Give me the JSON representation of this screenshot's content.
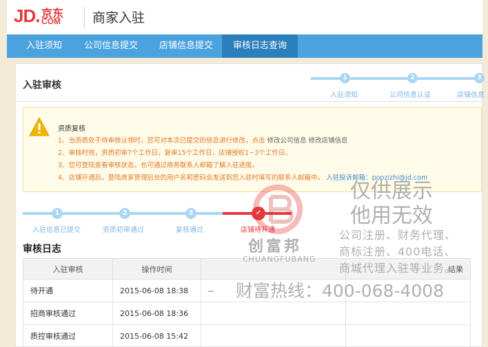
{
  "header": {
    "logo_jd": "JD.",
    "logo_cn": "京东",
    "logo_com": "COM",
    "title": "商家入驻"
  },
  "nav": {
    "items": [
      "入驻须知",
      "公司信息提交",
      "店铺信息提交",
      "审核日志查询"
    ],
    "active_index": 3
  },
  "panel": {
    "title": "入驻审核",
    "mini_steps": {
      "numbers": [
        "1",
        "2",
        "3"
      ],
      "labels": [
        "入驻须知",
        "公司信息认证",
        "店铺信息"
      ]
    }
  },
  "notice": {
    "title": "资质复核",
    "line1_prefix": "1、当资质处于待审核认领时，您可对本次已提交的信息进行修改，点击",
    "line1_link1": "修改公司信息",
    "line1_link2": "修改店铺信息",
    "line2": "2、审核时效，资质初审7个工作日，复审15个工作日，店铺授权1~3个工作日。",
    "line3": "3、您可登陆查看审核状态，也可通过商务联系人邮箱了解入驻进度。",
    "line4_prefix": "4、店铺开通后，登陆商家管理后台的用户名和密码会发送到您入驻时填写的联系人邮箱中。",
    "line4_link": "入驻投诉邮箱：popzizhi@jd.com"
  },
  "steps": {
    "numbers": [
      "1",
      "2",
      "3"
    ],
    "labels": [
      "入驻信息已提交",
      "资质初审通过",
      "复核通过",
      "店铺待开通"
    ],
    "current_index": 3
  },
  "log": {
    "title": "审核日志",
    "columns": [
      "入驻审核",
      "操作时间",
      "",
      "结果"
    ],
    "rows": [
      [
        "待开通",
        "2015-06-08 18:38",
        "--",
        ""
      ],
      [
        "招商审核通过",
        "2015-06-08 18:36",
        "",
        ""
      ],
      [
        "质控审核通过",
        "2015-06-08 15:42",
        "",
        ""
      ]
    ]
  },
  "watermark": {
    "line1": "仅供展示",
    "line2": "他用无效",
    "line3": "公司注册、财务代理、",
    "line4": "商标注册、400电话、",
    "line5": "商城代理入驻等业务。",
    "brand_cn": "创富邦",
    "brand_en": "CHUANGFUBANG",
    "hotline": "财富热线：400-068-4008"
  },
  "colors": {
    "brand_red": "#e4393c",
    "nav_blue": "#4aa3df",
    "nav_active": "#2c7fbd",
    "step_blue": "#a9d6f4",
    "step_red": "#e4393c"
  }
}
